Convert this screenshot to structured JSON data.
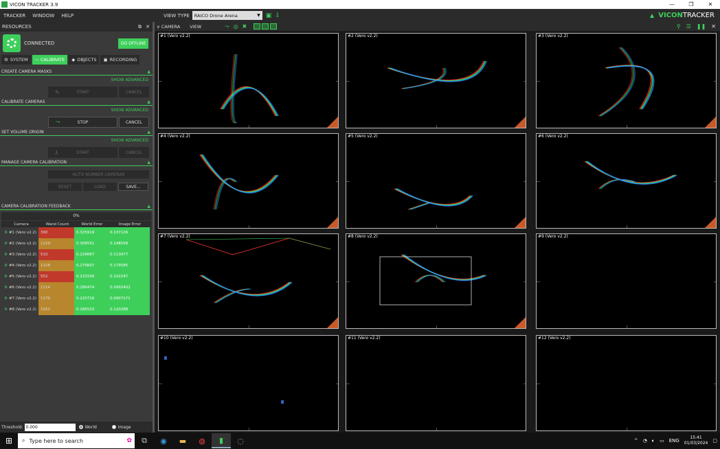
{
  "window": {
    "title": "VICON TRACKER 3.9",
    "minimize": "—",
    "maximize": "❐",
    "close": "✕"
  },
  "menu": {
    "tracker": "TRACKER",
    "window": "WINDOW",
    "help": "HELP",
    "view_type_label": "VIEW TYPE",
    "view_type_value": "RAICO Drone Arena",
    "logo": "VICON",
    "logo_b": "TRACKER"
  },
  "resources": {
    "title": "RESOURCES",
    "status": "CONNECTED",
    "go_offline": "GO OFFLINE",
    "tabs": [
      "SYSTEM",
      "CALIBRATE",
      "OBJECTS",
      "RECORDING"
    ],
    "sections": {
      "masks": {
        "title": "CREATE CAMERA MASKS",
        "show_advanced": "SHOW ADVANCED",
        "start": "START",
        "cancel": "CANCEL"
      },
      "calibrate": {
        "title": "CALIBRATE CAMERAS",
        "show_advanced": "SHOW ADVANCED",
        "stop": "STOP",
        "cancel": "CANCEL"
      },
      "origin": {
        "title": "SET VOLUME ORIGIN",
        "show_advanced": "SHOW ADVANCED",
        "start": "START",
        "cancel": "CANCEL"
      },
      "manage": {
        "title": "MANAGE CAMERA CALIBRATION",
        "auto_number": "AUTO NUMBER CAMERAS",
        "reset": "RESET",
        "load": "LOAD",
        "save": "SAVE..."
      },
      "feedback": {
        "title": "CAMERA CALIBRATION FEEDBACK",
        "progress": "0%"
      }
    },
    "table": {
      "headers": [
        "Camera",
        "Wand Count",
        "World Error",
        "Image Error"
      ],
      "rows": [
        {
          "camera": "#1 (Vero v2.2)",
          "wand": "390",
          "world": "0.325919",
          "image": "0.137126",
          "color": "#c0392b"
        },
        {
          "camera": "#2 (Vero v2.2)",
          "wand": "1229",
          "world": "0.308551",
          "image": "0.148558",
          "color": "#b8862c"
        },
        {
          "camera": "#3 (Vero v2.2)",
          "wand": "510",
          "world": "0.229687",
          "image": "0.113077",
          "color": "#c0392b"
        },
        {
          "camera": "#4 (Vero v2.2)",
          "wand": "1128",
          "world": "0.270607",
          "image": "0.179585",
          "color": "#b8862c"
        },
        {
          "camera": "#5 (Vero v2.2)",
          "wand": "552",
          "world": "0.223199",
          "image": "0.102247",
          "color": "#c0392b"
        },
        {
          "camera": "#6 (Vero v2.2)",
          "wand": "1114",
          "world": "0.286474",
          "image": "0.0992402",
          "color": "#b8862c"
        },
        {
          "camera": "#7 (Vero v2.2)",
          "wand": "1170",
          "world": "0.220716",
          "image": "0.0907171",
          "color": "#b8862c"
        },
        {
          "camera": "#8 (Vero v2.2)",
          "wand": "1052",
          "world": "0.185533",
          "image": "0.120288",
          "color": "#b8862c"
        }
      ]
    },
    "threshold": {
      "label": "Threshold:",
      "value": "0.000",
      "world": "World",
      "image": "Image"
    }
  },
  "camera_panel": {
    "toolbar_camera": "CAMERA",
    "toolbar_view": "VIEW"
  },
  "cameras": [
    "#1 (Vero v2.2)",
    "#2 (Vero v2.2)",
    "#3 (Vero v2.2)",
    "#4 (Vero v2.2)",
    "#5 (Vero v2.2)",
    "#6 (Vero v2.2)",
    "#7 (Vero v2.2)",
    "#8 (Vero v2.2)",
    "#9 (Vero v2.2)",
    "#10 (Vero v2.2)",
    "#11 (Vero v2.2)",
    "#12 (Vero v2.2)"
  ],
  "taskbar": {
    "search_placeholder": "Type here to search",
    "lang": "ENG",
    "time": "15:41",
    "date": "01/03/2024"
  }
}
